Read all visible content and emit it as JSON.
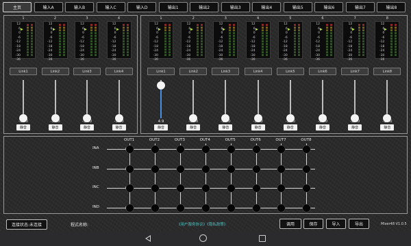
{
  "tabs": [
    "主页",
    "输入A",
    "输入B",
    "输入C",
    "输入D",
    "输出1",
    "输出2",
    "输出3",
    "输出4",
    "输出5",
    "输出6",
    "输出7",
    "输出8"
  ],
  "meter_scale": [
    "12",
    "6",
    "0",
    "-6",
    "-12",
    "-18",
    "-24",
    "-30",
    "-36"
  ],
  "mute_label": "静音",
  "inputs": [
    {
      "num": "1",
      "link": "Link1",
      "value": "-36.0",
      "level": 0
    },
    {
      "num": "2",
      "link": "Link2",
      "value": "-36.0",
      "level": 0
    },
    {
      "num": "3",
      "link": "Link3",
      "value": "-36.0",
      "level": 0
    },
    {
      "num": "4",
      "link": "Link4",
      "value": "-36.0",
      "level": 0
    }
  ],
  "outputs": [
    {
      "num": "1",
      "link": "Link1",
      "value": "4.9",
      "level": 0.85
    },
    {
      "num": "2",
      "link": "Link2",
      "value": "-36.0",
      "level": 0
    },
    {
      "num": "3",
      "link": "Link3",
      "value": "-36.0",
      "level": 0
    },
    {
      "num": "4",
      "link": "Link4",
      "value": "-36.0",
      "level": 0
    },
    {
      "num": "5",
      "link": "Link5",
      "value": "-36.0",
      "level": 0
    },
    {
      "num": "6",
      "link": "Link6",
      "value": "-36.0",
      "level": 0
    },
    {
      "num": "7",
      "link": "Link7",
      "value": "-36.0",
      "level": 0
    },
    {
      "num": "8",
      "link": "Link8",
      "value": "-36.0",
      "level": 0
    }
  ],
  "matrix": {
    "out_labels": [
      "OUT1",
      "OUT2",
      "OUT3",
      "OUT4",
      "OUT5",
      "OUT6",
      "OUT7",
      "OUT8"
    ],
    "in_labels": [
      "INA",
      "INB",
      "INC",
      "IND"
    ]
  },
  "bottom": {
    "connection_btn": "连接状态:未连接",
    "scheme_label": "程式名称:",
    "privacy_links": "《用户服务协议》《隐私政策》",
    "recall_btn": "调用",
    "save_btn": "保存",
    "import_btn": "导入",
    "export_btn": "导出",
    "version": "Mixer48 V1.0.5"
  },
  "colors": {
    "accent": "#4a90e2",
    "link_text": "#4fc0c0",
    "meter_marker": "#a8d14a"
  }
}
